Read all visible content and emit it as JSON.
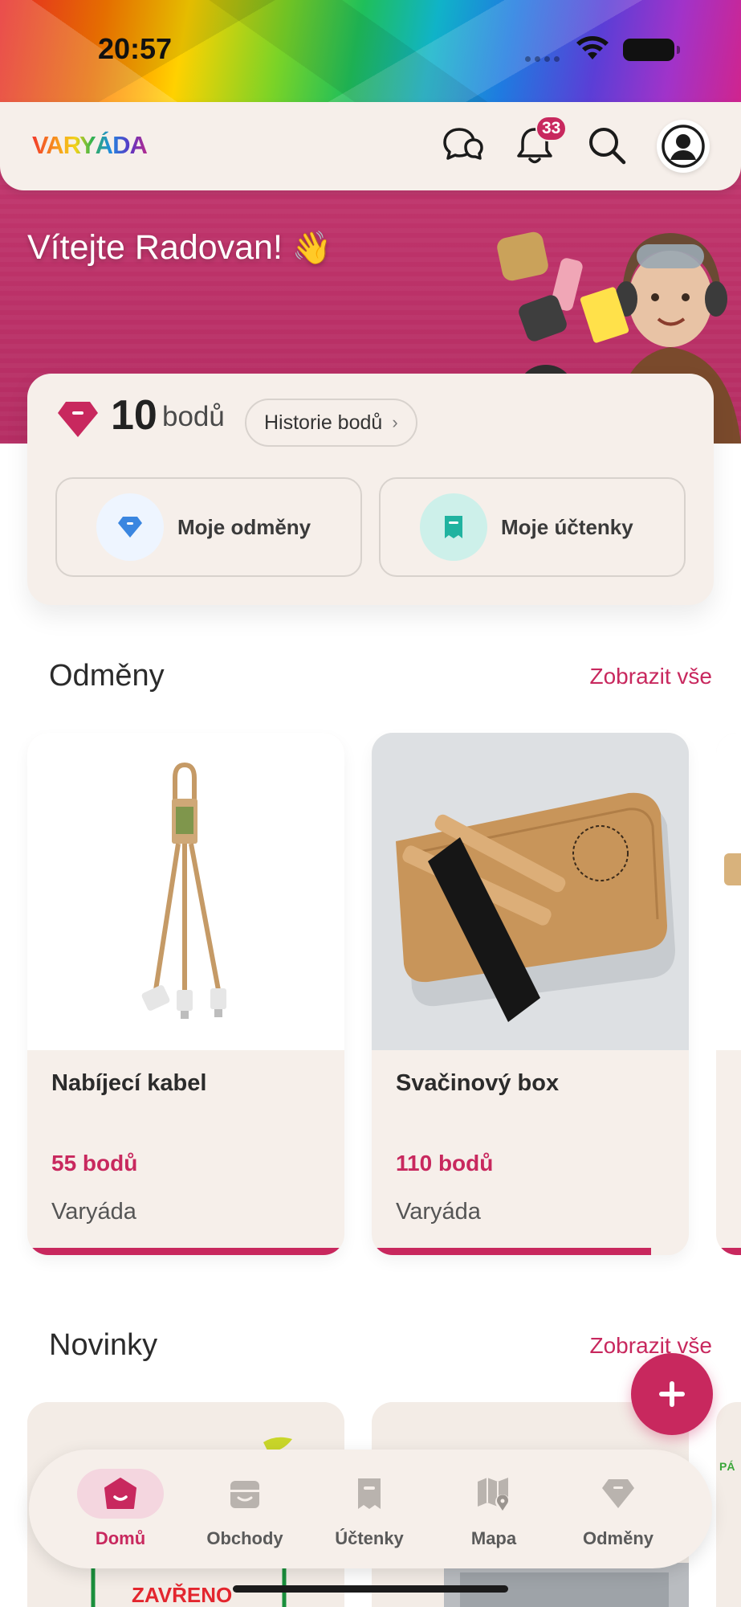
{
  "status_bar": {
    "time": "20:57"
  },
  "header": {
    "logo_text": "VARYÁDA",
    "notification_count": "33",
    "icons": [
      "chat-icon",
      "bell-icon",
      "search-icon",
      "profile-icon"
    ]
  },
  "hero": {
    "welcome": "Vítejte Radovan!",
    "wave_emoji": "👋"
  },
  "points": {
    "value": "10",
    "unit": "bodů",
    "history_label": "Historie bodů",
    "history_chevron": "›",
    "buttons": [
      {
        "label": "Moje odměny",
        "icon": "diamond-icon"
      },
      {
        "label": "Moje účtenky",
        "icon": "receipt-icon"
      }
    ]
  },
  "rewards": {
    "title": "Odměny",
    "see_all": "Zobrazit vše",
    "items": [
      {
        "name": "Nabíjecí kabel",
        "price": "55 bodů",
        "shop": "Varyáda",
        "progress": 1.0
      },
      {
        "name": "Svačinový box",
        "price": "110 bodů",
        "shop": "Varyáda",
        "progress": 0.88
      }
    ]
  },
  "news": {
    "title": "Novinky",
    "see_all": "Zobrazit vše",
    "items": [
      {
        "banner_text": "ZAVŘENO"
      },
      {
        "banner_text": ""
      }
    ],
    "peek_text": "PÁ"
  },
  "fab": {
    "icon": "plus-icon"
  },
  "nav": {
    "items": [
      {
        "label": "Domů",
        "icon": "home-icon",
        "active": true
      },
      {
        "label": "Obchody",
        "icon": "store-icon",
        "active": false
      },
      {
        "label": "Účtenky",
        "icon": "receipt-icon",
        "active": false
      },
      {
        "label": "Mapa",
        "icon": "map-icon",
        "active": false
      },
      {
        "label": "Odměny",
        "icon": "diamond-icon",
        "active": false
      }
    ]
  },
  "colors": {
    "accent": "#c8285e",
    "hero_bg": "#bb3168",
    "card_bg": "#f6efea",
    "text": "#2b2b2b"
  }
}
